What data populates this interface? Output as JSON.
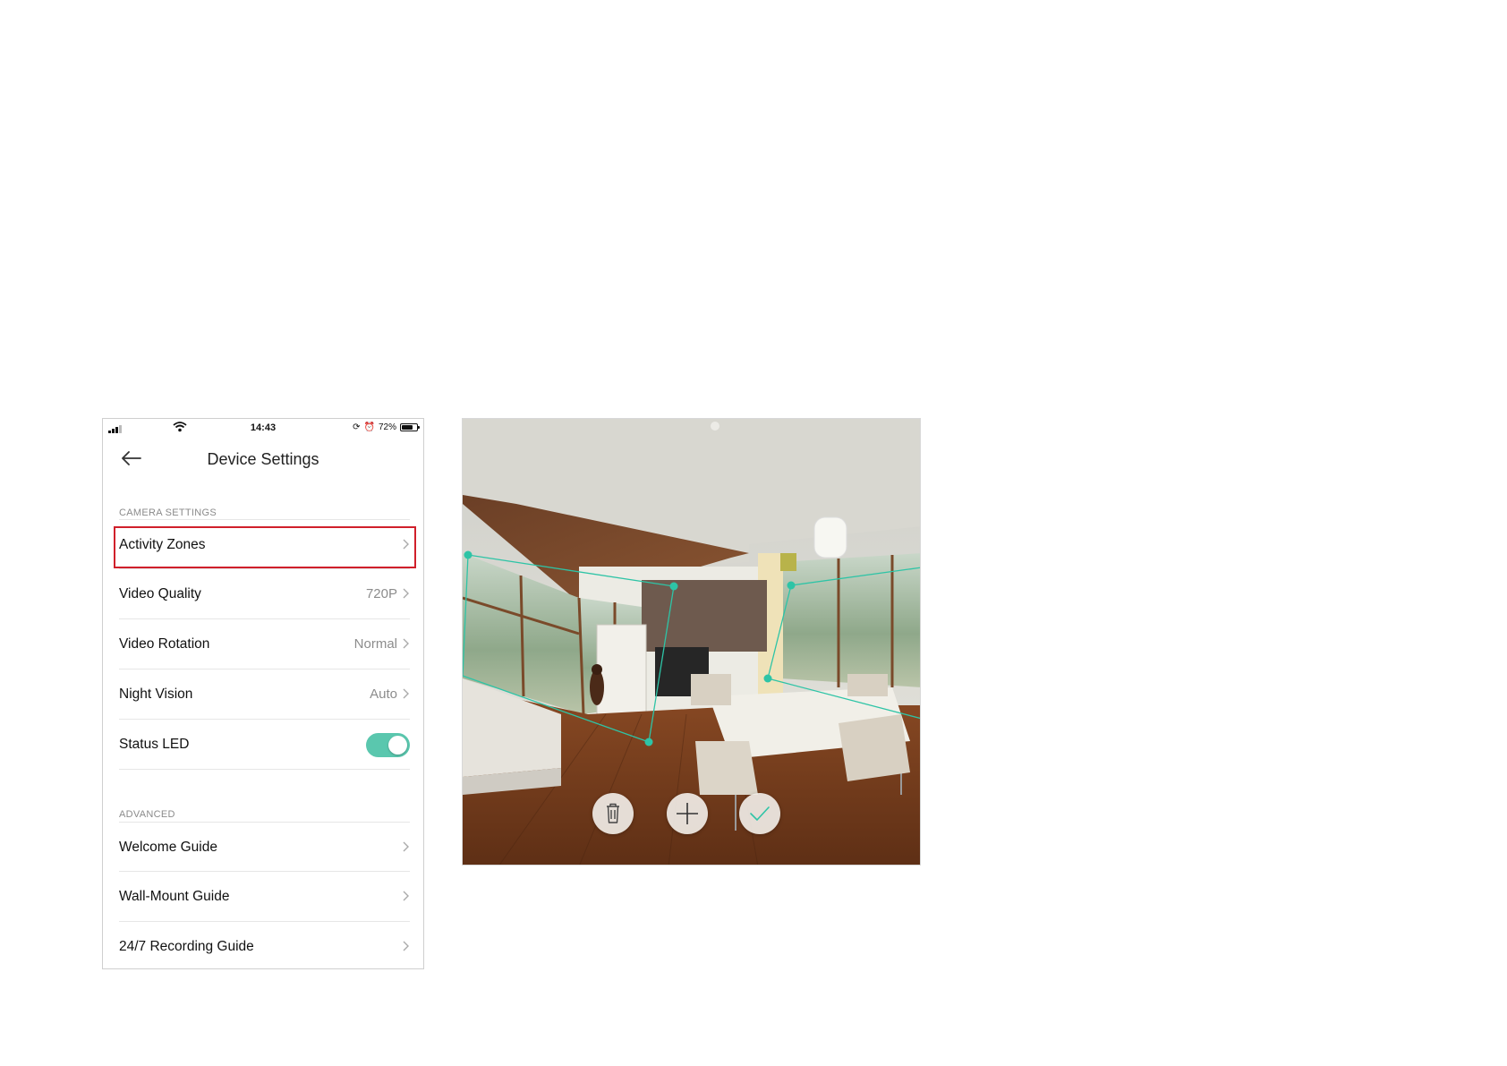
{
  "status_bar": {
    "time": "14:43",
    "battery": "72%",
    "battery_level": 0.72
  },
  "header": {
    "title": "Device Settings",
    "back_icon": "arrow-left-icon"
  },
  "sections": [
    {
      "header": "CAMERA SETTINGS",
      "items": [
        {
          "label": "Activity Zones",
          "value": "",
          "control": "chevron",
          "highlighted": true
        },
        {
          "label": "Video Quality",
          "value": "720P",
          "control": "chevron"
        },
        {
          "label": "Video Rotation",
          "value": "Normal",
          "control": "chevron"
        },
        {
          "label": "Night Vision",
          "value": "Auto",
          "control": "chevron"
        },
        {
          "label": "Status LED",
          "value": "",
          "control": "toggle",
          "toggle_on": true
        }
      ]
    },
    {
      "header": "ADVANCED",
      "items": [
        {
          "label": "Welcome Guide",
          "value": "",
          "control": "chevron"
        },
        {
          "label": "Wall-Mount Guide",
          "value": "",
          "control": "chevron"
        },
        {
          "label": "24/7 Recording Guide",
          "value": "",
          "control": "chevron"
        }
      ]
    }
  ],
  "camera_view": {
    "zone_color": "#2ec4a6",
    "controls": [
      {
        "name": "delete-zone-button",
        "icon": "trash-icon"
      },
      {
        "name": "add-zone-button",
        "icon": "plus-icon"
      },
      {
        "name": "confirm-zones-button",
        "icon": "check-icon"
      }
    ]
  },
  "colors": {
    "accent": "#5ac7ae",
    "highlight": "#d0202b"
  }
}
